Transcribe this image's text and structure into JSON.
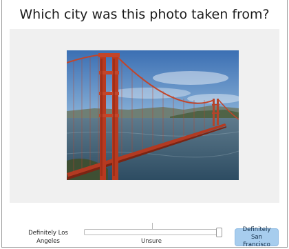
{
  "question": "Which city was this photo taken from?",
  "photo": {
    "icon": "golden-gate-bridge-photo"
  },
  "slider": {
    "left_label": "Definitely Los Angeles",
    "center_label": "Unsure",
    "right_label": "Definitely San Francisco",
    "value_fraction": 1.0
  },
  "colors": {
    "panel_bg": "#f0f0f0",
    "selected_button": "#a7cdee",
    "bridge": "#c2452a"
  }
}
